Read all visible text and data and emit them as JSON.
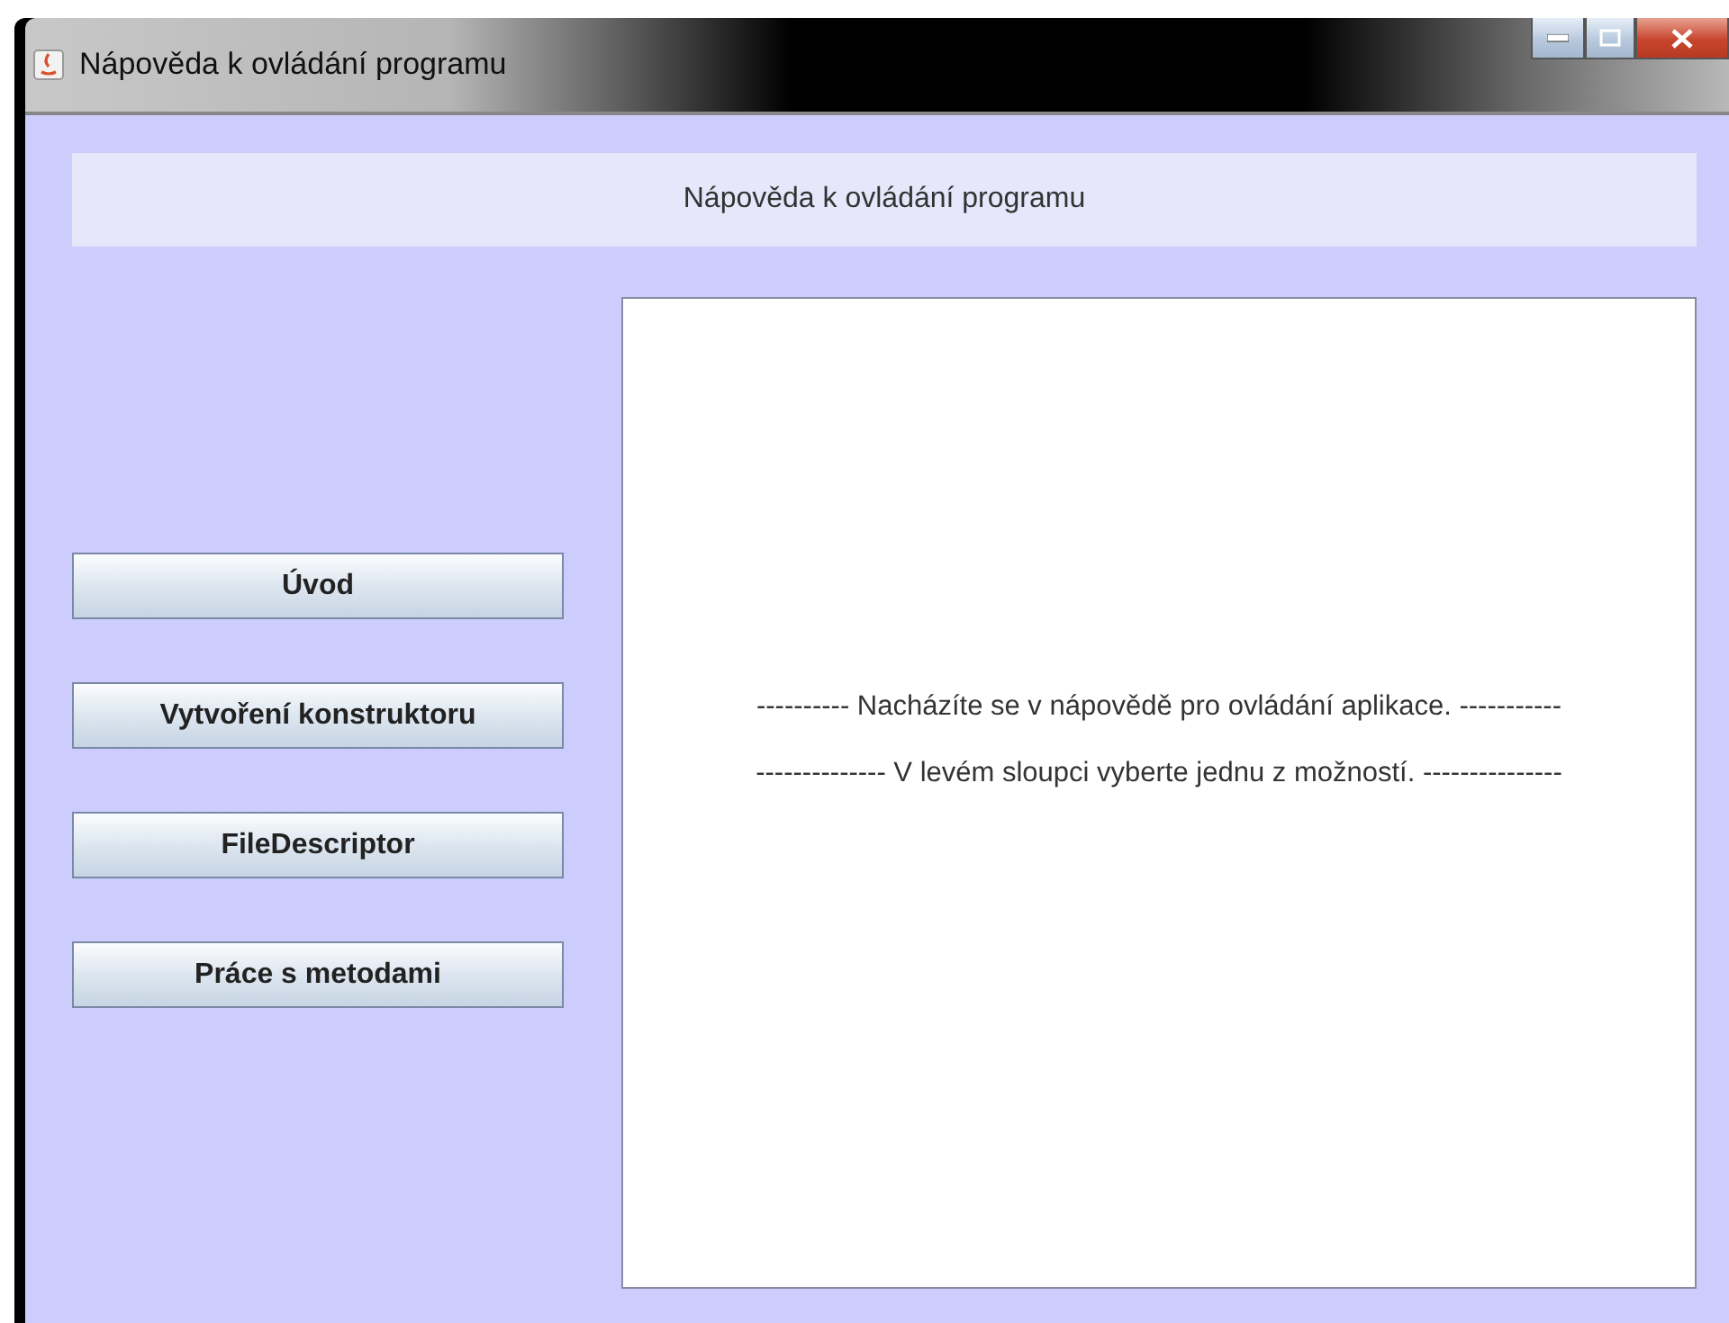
{
  "window": {
    "title": "Nápověda k ovládání programu"
  },
  "header": {
    "text": "Nápověda k ovládání programu"
  },
  "buttons": [
    {
      "label": "Úvod"
    },
    {
      "label": "Vytvoření konstruktoru"
    },
    {
      "label": "FileDescriptor"
    },
    {
      "label": "Práce s metodami"
    }
  ],
  "content": {
    "lines": [
      "---------- Nacházíte se v nápovědě pro ovládání aplikace. -----------",
      "-------------- V levém sloupci vyberte jednu z možností. ---------------"
    ]
  }
}
